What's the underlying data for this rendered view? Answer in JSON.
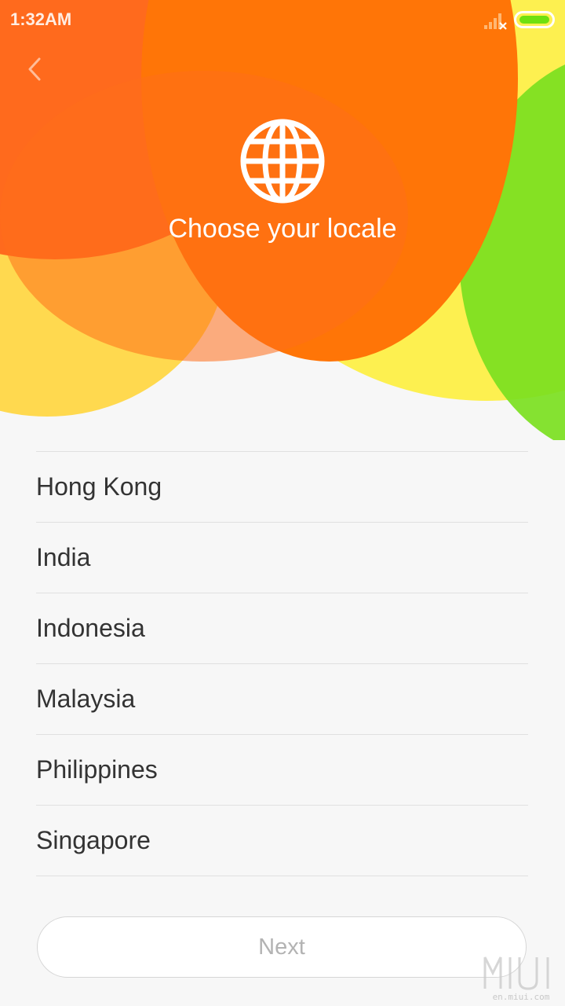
{
  "status_bar": {
    "time": "1:32AM",
    "icons": [
      "signal-icon",
      "battery-icon"
    ]
  },
  "header": {
    "back_icon": "chevron-left-icon",
    "globe_icon": "globe-icon",
    "title": "Choose your locale"
  },
  "locales": [
    {
      "label": "Hong Kong"
    },
    {
      "label": "India"
    },
    {
      "label": "Indonesia"
    },
    {
      "label": "Malaysia"
    },
    {
      "label": "Philippines"
    },
    {
      "label": "Singapore"
    }
  ],
  "footer": {
    "next_label": "Next"
  },
  "watermark": {
    "logo": "MIUI",
    "url": "en.miui.com"
  },
  "colors": {
    "orange": "#ff7507",
    "yellow": "#fdf050",
    "green": "#7be020",
    "background": "#f7f7f7",
    "text": "#333333"
  }
}
